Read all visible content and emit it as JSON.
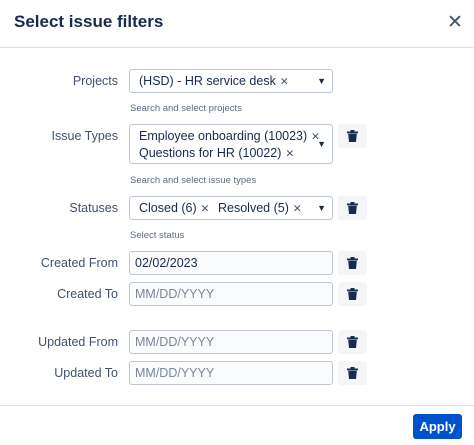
{
  "dialog": {
    "title": "Select issue filters",
    "close_icon": "close-icon"
  },
  "projects": {
    "label": "Projects",
    "chips": [
      "(HSD) - HR service desk"
    ],
    "helper": "Search and select projects"
  },
  "issue_types": {
    "label": "Issue Types",
    "chips": [
      "Employee onboarding (10023)",
      "Questions for HR (10022)"
    ],
    "helper": "Search and select issue types"
  },
  "statuses": {
    "label": "Statuses",
    "chips": [
      "Closed (6)",
      "Resolved (5)"
    ],
    "helper": "Select status"
  },
  "created_from": {
    "label": "Created From",
    "value": "02/02/2023",
    "placeholder": "MM/DD/YYYY"
  },
  "created_to": {
    "label": "Created To",
    "value": "",
    "placeholder": "MM/DD/YYYY"
  },
  "updated_from": {
    "label": "Updated From",
    "value": "",
    "placeholder": "MM/DD/YYYY"
  },
  "updated_to": {
    "label": "Updated To",
    "value": "",
    "placeholder": "MM/DD/YYYY"
  },
  "footer": {
    "apply_label": "Apply"
  },
  "icons": {
    "remove": "×",
    "caret": "chevron-down-icon",
    "delete": "trash-icon"
  },
  "colors": {
    "primary": "#0052cc",
    "text": "#172b4d",
    "subtle": "#42526e",
    "border": "#c1c7d0"
  }
}
